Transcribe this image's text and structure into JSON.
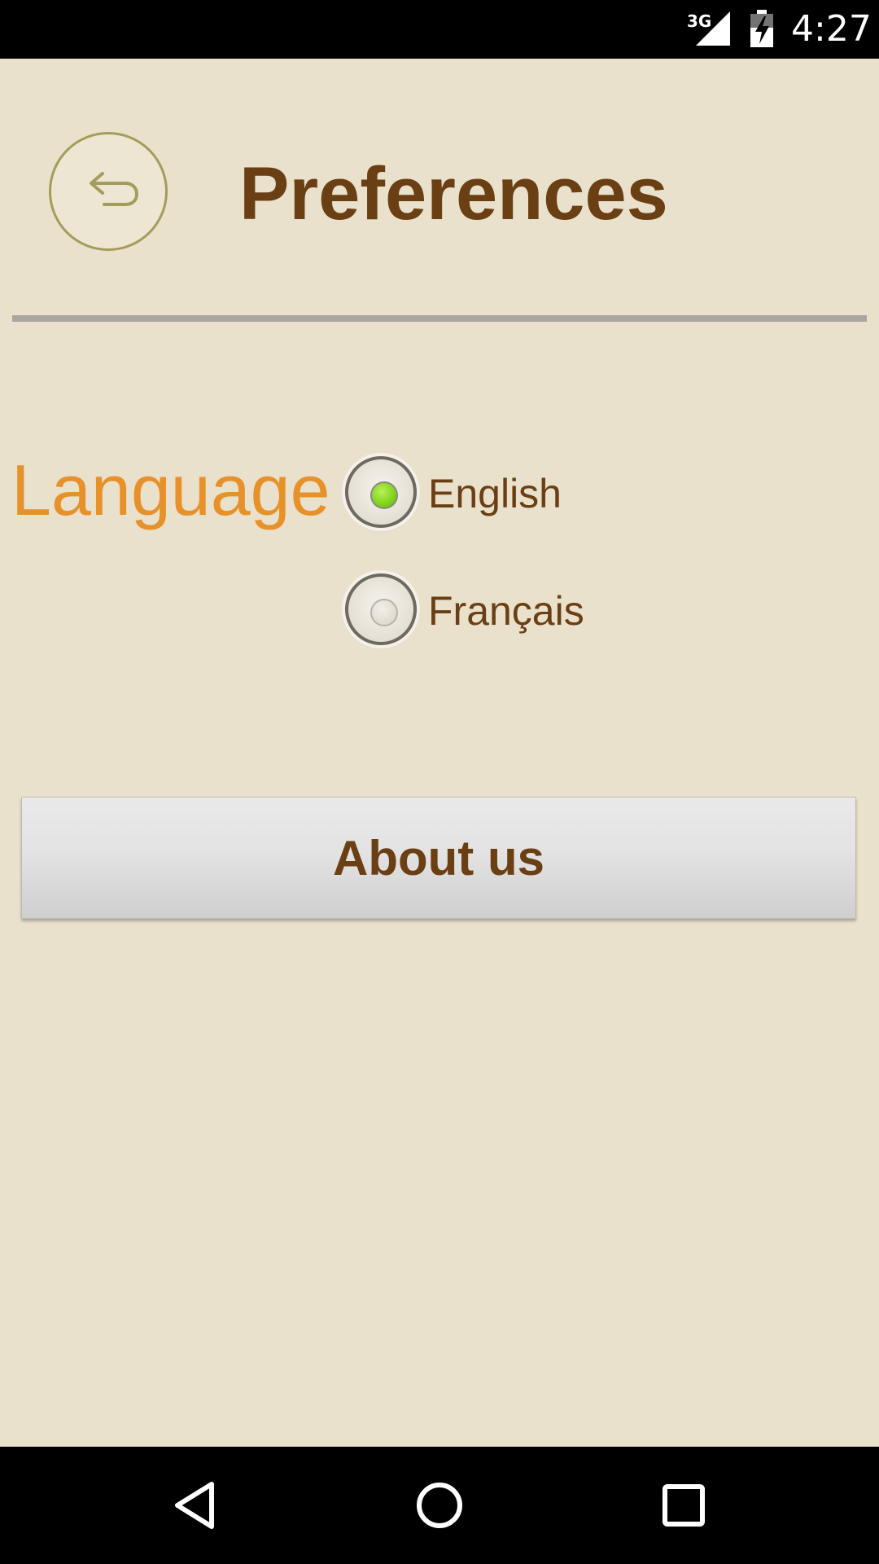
{
  "status_bar": {
    "network": "3G",
    "time": "4:27"
  },
  "header": {
    "title": "Preferences",
    "back_icon": "back-arrow-icon"
  },
  "language": {
    "label": "Language",
    "options": [
      {
        "label": "English",
        "selected": true
      },
      {
        "label": "Français",
        "selected": false
      }
    ]
  },
  "about": {
    "label": "About us"
  },
  "colors": {
    "background": "#e9e1cc",
    "title": "#6b3f14",
    "language_label": "#e6912a",
    "radio_selected": "#7fd319",
    "back_button_border": "#a39c5a"
  },
  "nav_bar": {
    "icons": [
      "back-triangle-icon",
      "home-circle-icon",
      "recents-square-icon"
    ]
  }
}
